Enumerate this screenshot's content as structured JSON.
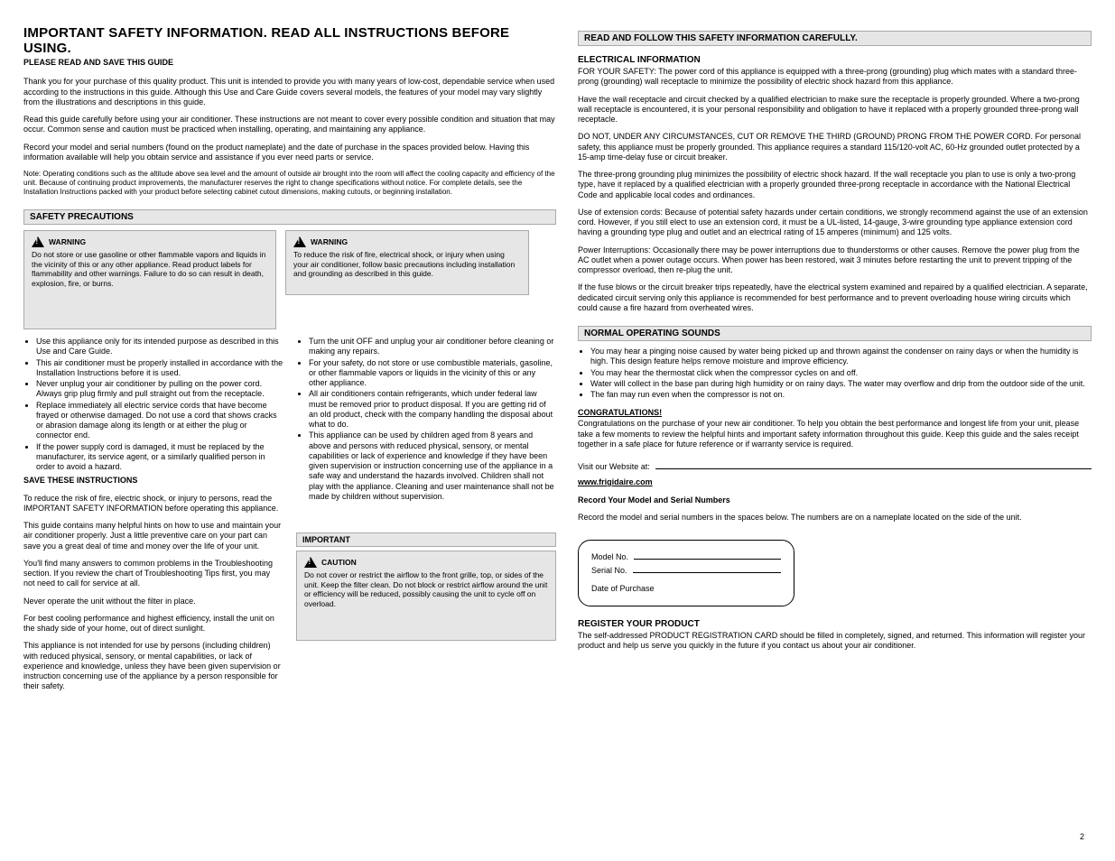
{
  "left": {
    "title": "IMPORTANT SAFETY INFORMATION. READ ALL INSTRUCTIONS BEFORE USING.",
    "subtitle": "PLEASE READ AND SAVE THIS GUIDE",
    "intro1": "Thank you for your purchase of this quality product. This unit is intended to provide you with many years of low-cost, dependable service when used according to the instructions in this guide. Although this Use and Care Guide covers several models, the features of your model may vary slightly from the illustrations and descriptions in this guide.",
    "intro2": "Read this guide carefully before using your air conditioner. These instructions are not meant to cover every possible condition and situation that may occur. Common sense and caution must be practiced when installing, operating, and maintaining any appliance.",
    "intro3": "Record your model and serial numbers (found on the product nameplate) and the date of purchase in the spaces provided below. Having this information available will help you obtain service and assistance if you ever need parts or service.",
    "intro_note": "Note: Operating conditions such as the altitude above sea level and the amount of outside air brought into the room will affect the cooling capacity and efficiency of the unit. Because of continuing product improvements, the manufacturer reserves the right to change specifications without notice. For complete details, see the Installation Instructions packed with your product before selecting cabinet cutout dimensions, making cutouts, or beginning installation.",
    "safety_bar": "SAFETY PRECAUTIONS",
    "warn_left_title": "WARNING",
    "warn_left_body": "Do not store or use gasoline or other flammable vapors and liquids in the vicinity of this or any other appliance. Read product labels for flammability and other warnings. Failure to do so can result in death, explosion, fire, or burns.",
    "warn_right_title": "WARNING",
    "warn_right_body": "To reduce the risk of fire, electrical shock, or injury when using your air conditioner, follow basic precautions including installation and grounding as described in this guide.",
    "bullets": [
      "Use this appliance only for its intended purpose as described in this Use and Care Guide.",
      "This air conditioner must be properly installed in accordance with the Installation Instructions before it is used.",
      "Never unplug your air conditioner by pulling on the power cord. Always grip plug firmly and pull straight out from the receptacle.",
      "Replace immediately all electric service cords that have become frayed or otherwise damaged. Do not use a cord that shows cracks or abrasion damage along its length or at either the plug or connector end.",
      "If the power supply cord is damaged, it must be replaced by the manufacturer, its service agent, or a similarly qualified person in order to avoid a hazard.",
      "Turn the unit OFF and unplug your air conditioner before cleaning or making any repairs.",
      "For your safety, do not store or use combustible materials, gasoline, or other flammable vapors or liquids in the vicinity of this or any other appliance.",
      "All air conditioners contain refrigerants, which under federal law must be removed prior to product disposal. If you are getting rid of an old product, check with the company handling the disposal about what to do.",
      "This appliance can be used by children aged from 8 years and above and persons with reduced physical, sensory, or mental capabilities or lack of experience and knowledge if they have been given supervision or instruction concerning use of the appliance in a safe way and understand the hazards involved. Children shall not play with the appliance. Cleaning and user maintenance shall not be made by children without supervision."
    ],
    "save_text": "SAVE THESE INSTRUCTIONS",
    "right_sub_bar": "IMPORTANT",
    "right_sub_warn_title": "CAUTION",
    "right_sub_warn_body": "Do not cover or restrict the airflow to the front grille, top, or sides of the unit. Keep the filter clean. Do not block or restrict airflow around the unit or efficiency will be reduced, possibly causing the unit to cycle off on overload.",
    "right_sub_para1": "To reduce the risk of fire, electric shock, or injury to persons, read the IMPORTANT SAFETY INFORMATION before operating this appliance.",
    "right_sub_para2": "This guide contains many helpful hints on how to use and maintain your air conditioner properly. Just a little preventive care on your part can save you a great deal of time and money over the life of your unit.",
    "right_sub_para3": "You'll find many answers to common problems in the Troubleshooting section. If you review the chart of Troubleshooting Tips first, you may not need to call for service at all.",
    "right_sub_para4": "Never operate the unit without the filter in place.",
    "right_sub_para5": "For best cooling performance and highest efficiency, install the unit on the shady side of your home, out of direct sunlight.",
    "right_sub_para6": "This appliance is not intended for use by persons (including children) with reduced physical, sensory, or mental capabilities, or lack of experience and knowledge, unless they have been given supervision or instruction concerning use of the appliance by a person responsible for their safety."
  },
  "right": {
    "bar1": "READ AND FOLLOW THIS SAFETY INFORMATION CAREFULLY.",
    "h1": "ELECTRICAL INFORMATION",
    "p1": "FOR YOUR SAFETY: The power cord of this appliance is equipped with a three-prong (grounding) plug which mates with a standard three-prong (grounding) wall receptacle to minimize the possibility of electric shock hazard from this appliance.",
    "p2": "Have the wall receptacle and circuit checked by a qualified electrician to make sure the receptacle is properly grounded. Where a two-prong wall receptacle is encountered, it is your personal responsibility and obligation to have it replaced with a properly grounded three-prong wall receptacle.",
    "p3": "DO NOT, UNDER ANY CIRCUMSTANCES, CUT OR REMOVE THE THIRD (GROUND) PRONG FROM THE POWER CORD. For personal safety, this appliance must be properly grounded. This appliance requires a standard 115/120-volt AC, 60-Hz grounded outlet protected by a 15-amp time-delay fuse or circuit breaker.",
    "p4": "The three-prong grounding plug minimizes the possibility of electric shock hazard. If the wall receptacle you plan to use is only a two-prong type, have it replaced by a qualified electrician with a properly grounded three-prong receptacle in accordance with the National Electrical Code and applicable local codes and ordinances.",
    "p5": "Use of extension cords: Because of potential safety hazards under certain conditions, we strongly recommend against the use of an extension cord. However, if you still elect to use an extension cord, it must be a UL-listed, 14-gauge, 3-wire grounding type appliance extension cord having a grounding type plug and outlet and an electrical rating of 15 amperes (minimum) and 125 volts.",
    "p6": "Power Interruptions: Occasionally there may be power interruptions due to thunderstorms or other causes. Remove the power plug from the AC outlet when a power outage occurs. When power has been restored, wait 3 minutes before restarting the unit to prevent tripping of the compressor overload, then re-plug the unit.",
    "p7": "If the fuse blows or the circuit breaker trips repeatedly, have the electrical system examined and repaired by a qualified electrician. A separate, dedicated circuit serving only this appliance is recommended for best performance and to prevent overloading house wiring circuits which could cause a fire hazard from overheated wires.",
    "bar2": "NORMAL OPERATING SOUNDS",
    "normal": [
      "You may hear a pinging noise caused by water being picked up and thrown against the condenser on rainy days or when the humidity is high. This design feature helps remove moisture and improve efficiency.",
      "You may hear the thermostat click when the compressor cycles on and off.",
      "Water will collect in the base pan during high humidity or on rainy days. The water may overflow and drip from the outdoor side of the unit.",
      "The fan may run even when the compressor is not on."
    ],
    "cong_h": "CONGRATULATIONS!",
    "cong_p": "Congratulations on the purchase of your new air conditioner. To help you obtain the best performance and longest life from your unit, please take a few moments to review the helpful hints and important safety information throughout this guide. Keep this guide and the sales receipt together in a safe place for future reference or if warranty service is required.",
    "visit": "Visit our Website at:",
    "site": "www.frigidaire.com",
    "record_title": "Record Your Model and Serial Numbers",
    "record_text": "Record the model and serial numbers in the spaces below. The numbers are on a nameplate located on the side of the unit.",
    "model": "Model No.",
    "serial": "Serial No.",
    "date": "Date of Purchase",
    "pref_h": "REGISTER YOUR PRODUCT",
    "pref_p": "The self-addressed PRODUCT REGISTRATION CARD should be filled in completely, signed, and returned. This information will register your product and help us serve you quickly in the future if you contact us about your air conditioner.",
    "page_no": "2"
  }
}
